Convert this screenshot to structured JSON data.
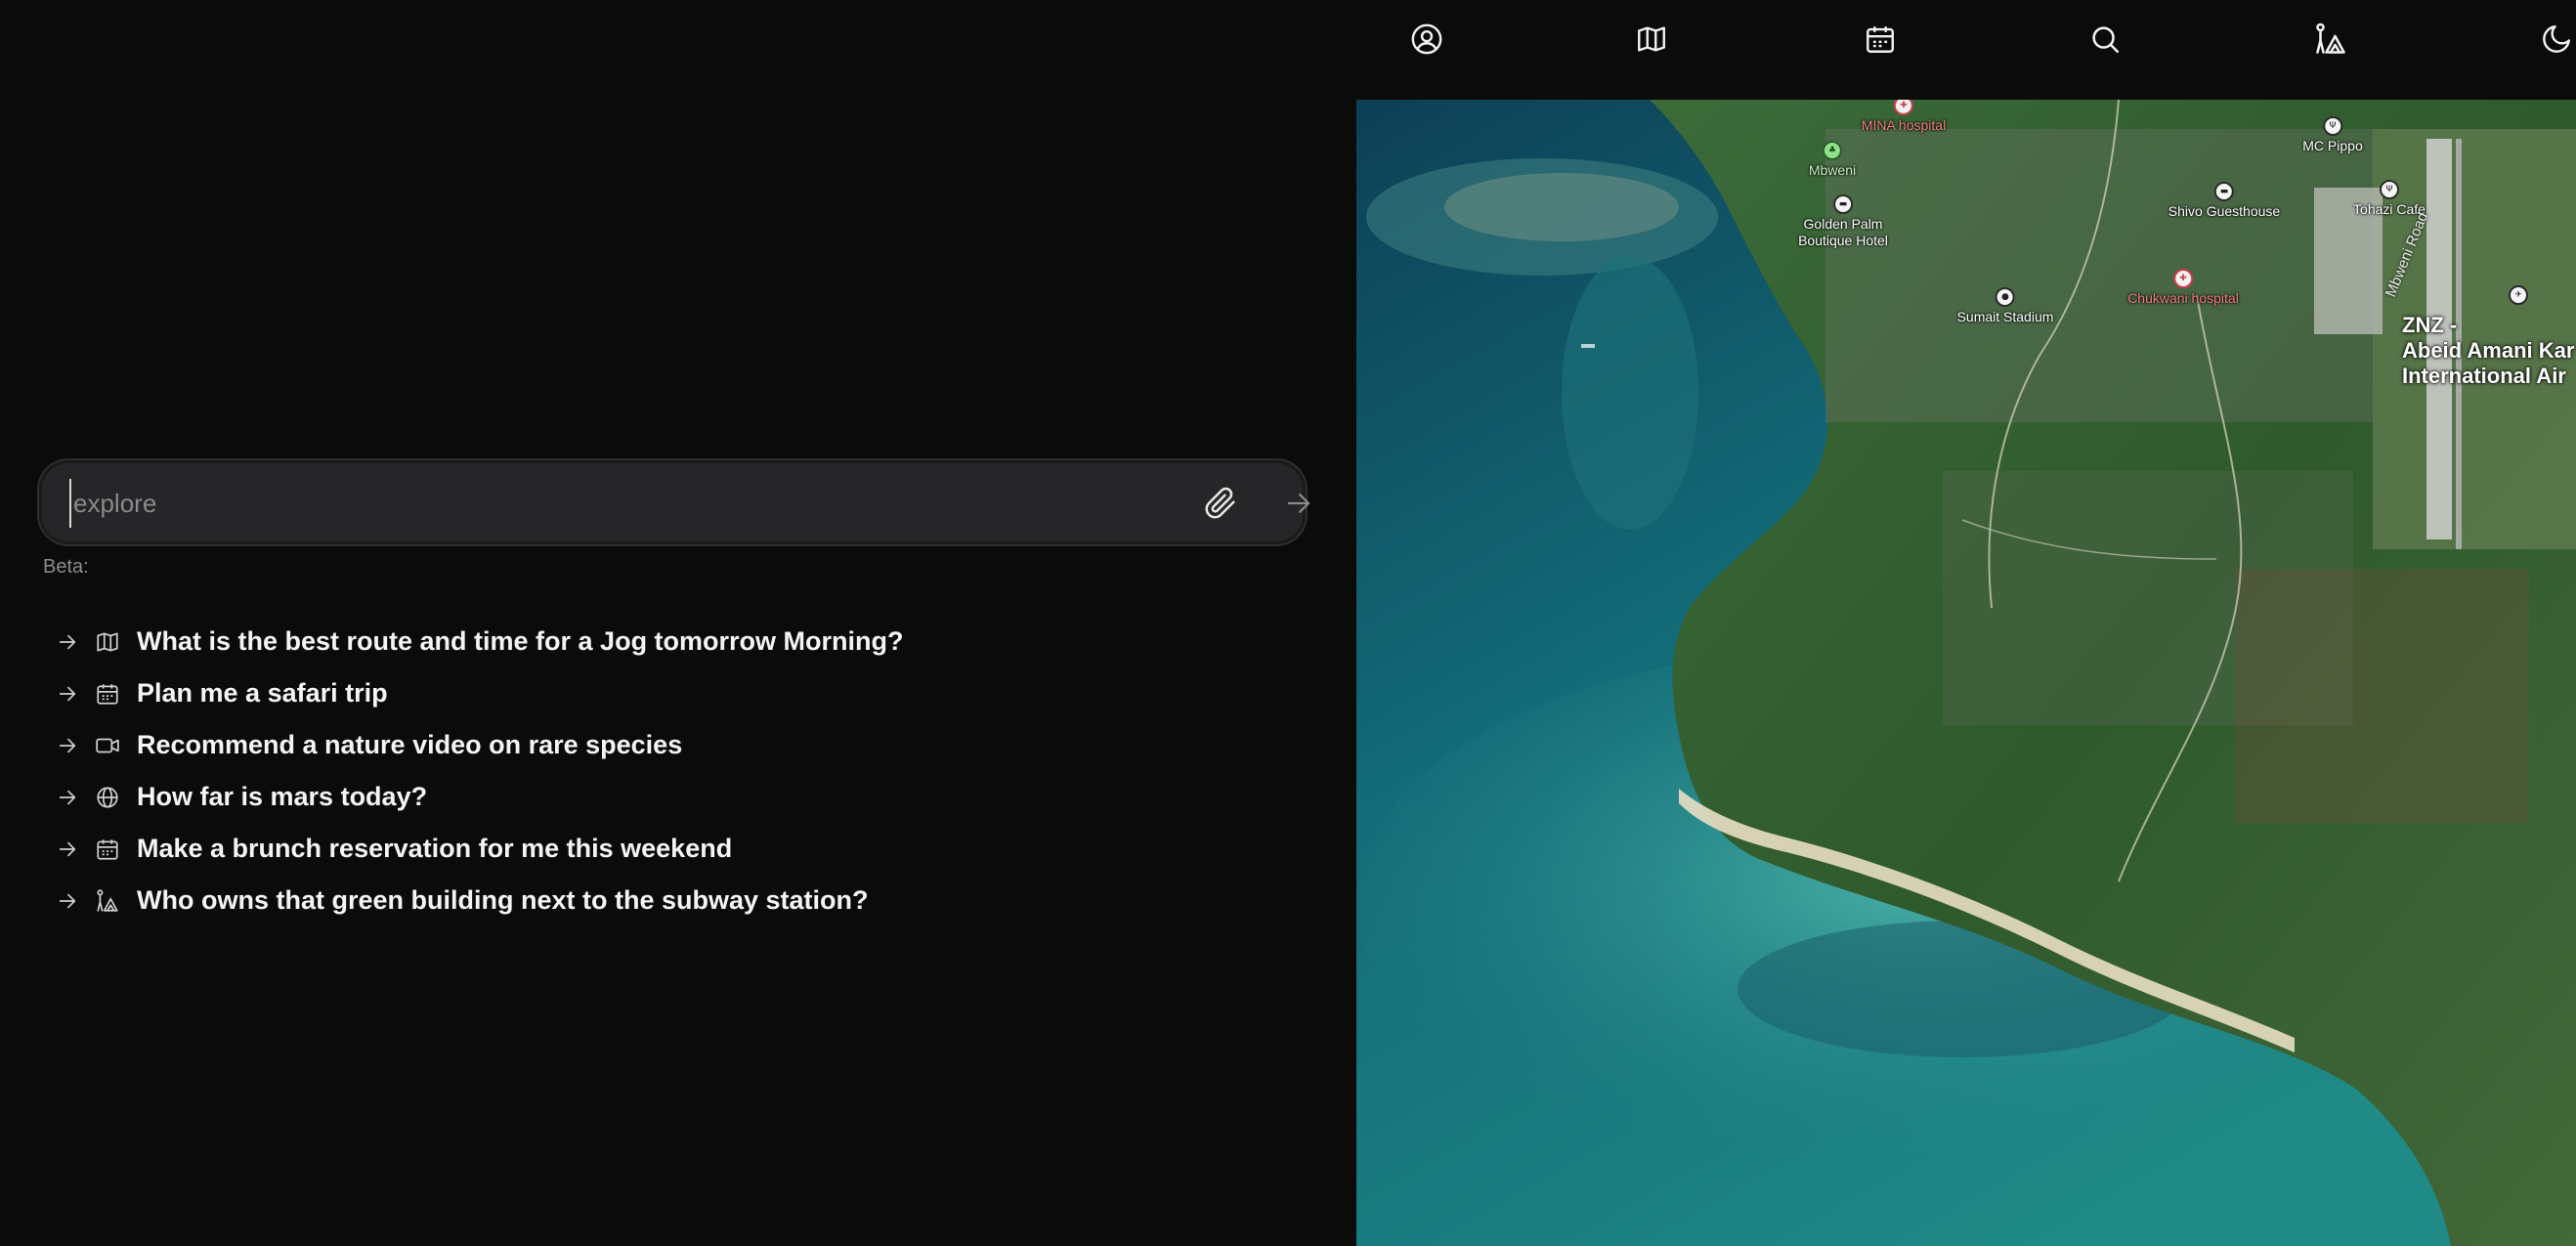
{
  "search": {
    "placeholder": "explore",
    "attach_icon": "paperclip-icon",
    "send_icon": "arrow-right-icon"
  },
  "beta_label": "Beta:",
  "suggestions": [
    {
      "icon": "map-icon",
      "label": "What is the best route and time for a Jog tomorrow Morning?"
    },
    {
      "icon": "calendar-icon",
      "label": "Plan me a safari trip"
    },
    {
      "icon": "video-icon",
      "label": "Recommend a nature video on rare species"
    },
    {
      "icon": "globe-icon",
      "label": "How far is mars today?"
    },
    {
      "icon": "calendar-icon",
      "label": "Make a brunch reservation for me this weekend"
    },
    {
      "icon": "person-landmark-icon",
      "label": "Who owns that green building next to the subway station?"
    }
  ],
  "toolbar": [
    {
      "icon": "user-circle-icon"
    },
    {
      "icon": "map-icon"
    },
    {
      "icon": "calendar-icon"
    },
    {
      "icon": "search-icon"
    },
    {
      "icon": "person-landmark-icon"
    },
    {
      "icon": "moon-icon"
    }
  ],
  "map": {
    "pois": [
      {
        "name": "MINA hospital",
        "type": "hospital"
      },
      {
        "name": "Mbweni",
        "type": "park"
      },
      {
        "name": "Golden Palm\nBoutique Hotel",
        "type": "hotel"
      },
      {
        "name": "Sumait Stadium",
        "type": "stadium"
      },
      {
        "name": "Chukwani hospital",
        "type": "hospital"
      },
      {
        "name": "Shivo Guesthouse",
        "type": "hotel"
      },
      {
        "name": "MC Pippo",
        "type": "restaurant"
      },
      {
        "name": "Tohazi Cafe",
        "type": "restaurant"
      }
    ],
    "road_label": "Mbweni Road",
    "airport_label": "ZNZ -\nAbeid Amani Kar\nInternational Air"
  },
  "colors": {
    "background": "#0b0b0c",
    "input_bg": "#262628",
    "text": "#f4f4f4",
    "muted": "#8b8b8e",
    "hospital": "#d13a4a"
  }
}
